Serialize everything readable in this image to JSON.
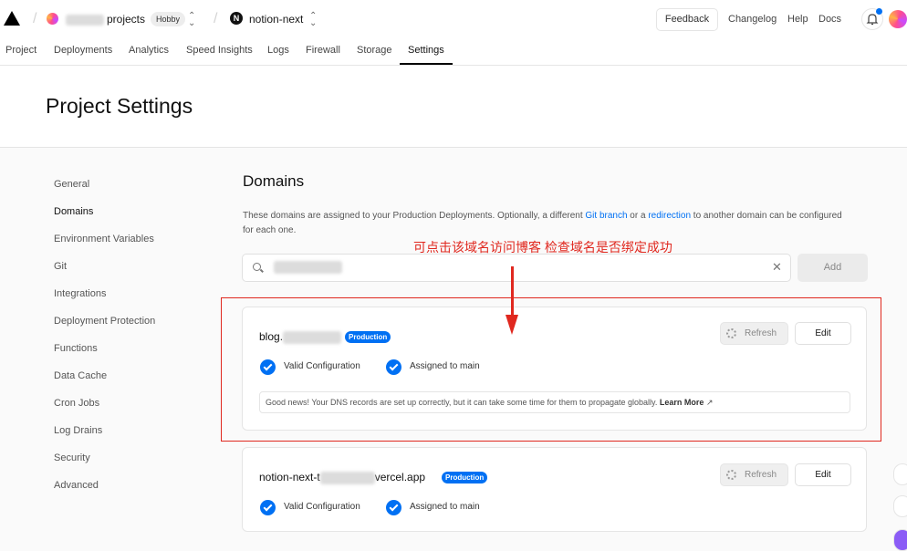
{
  "topbar": {
    "team_name": "projects",
    "plan_badge": "Hobby",
    "project_name": "notion-next",
    "feedback_label": "Feedback",
    "changelog_label": "Changelog",
    "help_label": "Help",
    "docs_label": "Docs"
  },
  "tabs": [
    "Project",
    "Deployments",
    "Analytics",
    "Speed Insights",
    "Logs",
    "Firewall",
    "Storage",
    "Settings"
  ],
  "active_tab": "Settings",
  "page_title": "Project Settings",
  "sidebar": {
    "items": [
      "General",
      "Domains",
      "Environment Variables",
      "Git",
      "Integrations",
      "Deployment Protection",
      "Functions",
      "Data Cache",
      "Cron Jobs",
      "Log Drains",
      "Security",
      "Advanced"
    ],
    "active": "Domains"
  },
  "domains": {
    "title": "Domains",
    "desc_part1": "These domains are assigned to your Production Deployments. Optionally, a different ",
    "desc_link1": "Git branch",
    "desc_part2": " or a ",
    "desc_link2": "redirection",
    "desc_part3": " to another domain can be configured for each one.",
    "search_placeholder": "",
    "add_label": "Add"
  },
  "annotation": {
    "callout": "可点击该域名访问博客 检查域名是否绑定成功",
    "color": "#e0281f"
  },
  "cards": [
    {
      "domain_prefix": "blog.",
      "domain_suffix": "",
      "badge": "Production",
      "status1": "Valid Configuration",
      "status2": "Assigned to main",
      "refresh_label": "Refresh",
      "edit_label": "Edit",
      "note": "Good news! Your DNS records are set up correctly, but it can take some time for them to propagate globally.",
      "note_link": "Learn More"
    },
    {
      "domain_prefix": "notion-next-t",
      "domain_suffix": "vercel.app",
      "badge": "Production",
      "status1": "Valid Configuration",
      "status2": "Assigned to main",
      "refresh_label": "Refresh",
      "edit_label": "Edit"
    }
  ],
  "colors": {
    "accent": "#0070f3",
    "annotation": "#e0281f"
  }
}
